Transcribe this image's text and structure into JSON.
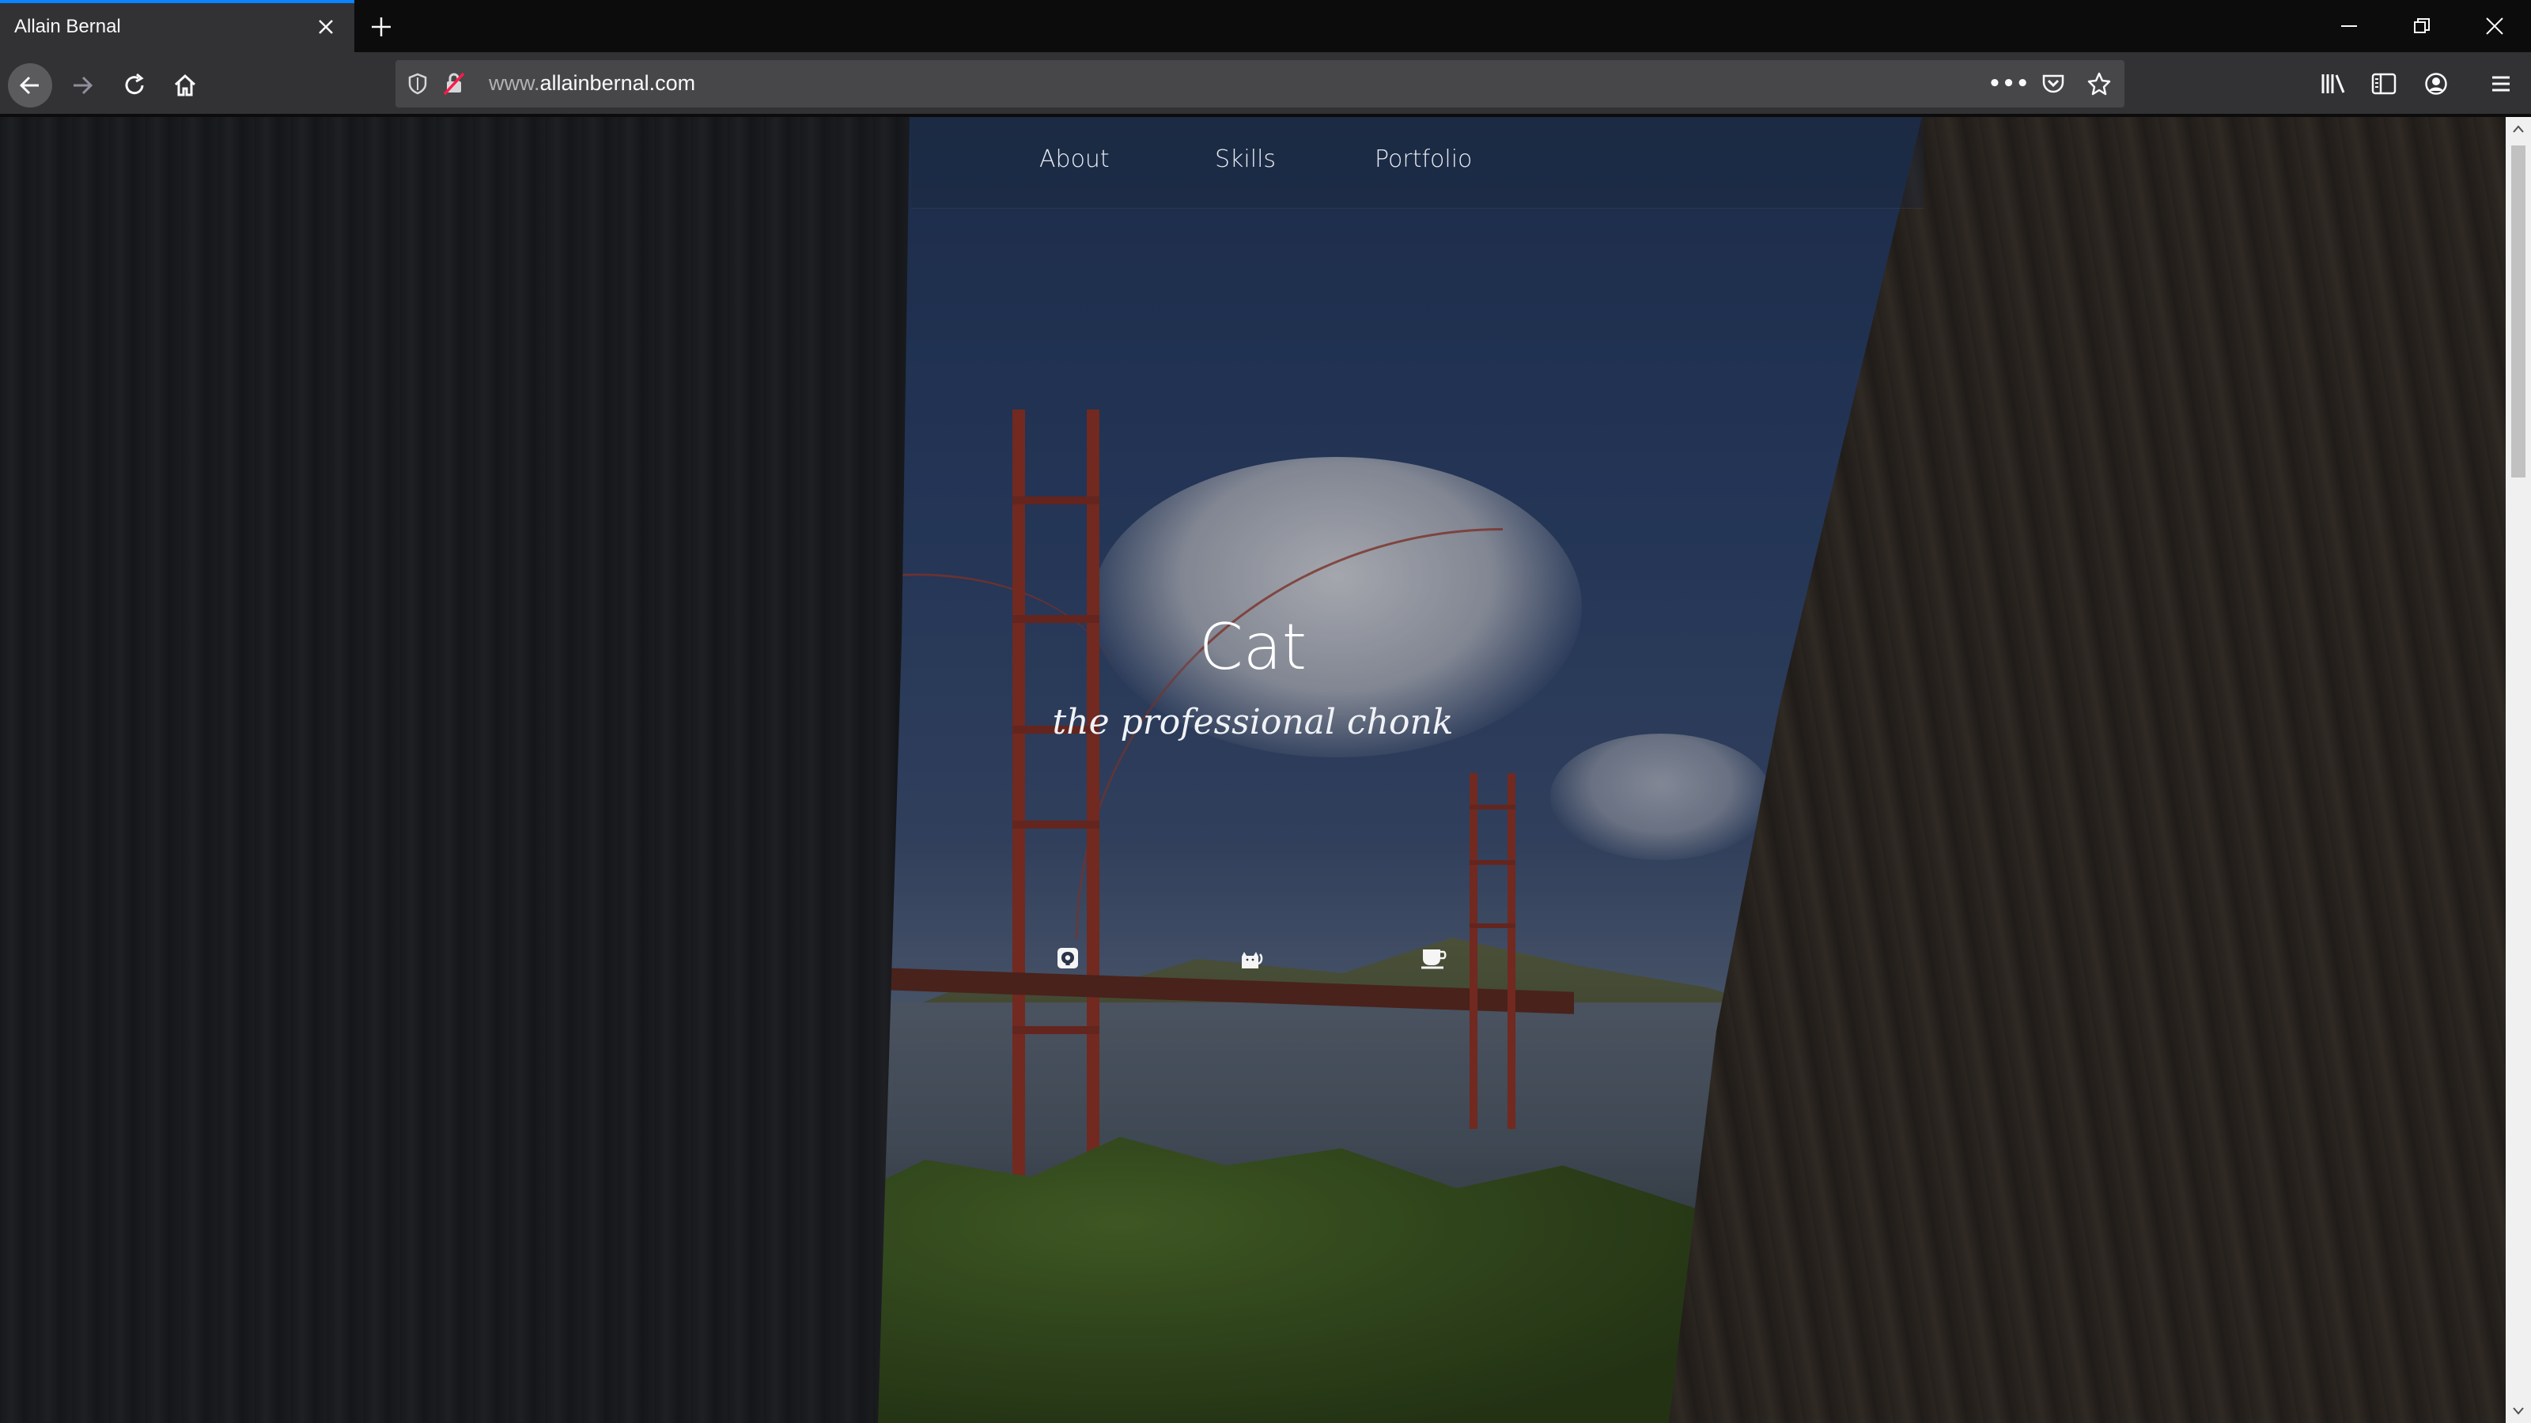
{
  "browser": {
    "tab_title": "Allain Bernal",
    "url_prefix": "www.",
    "url_host": "allainbernal.com",
    "page_actions_label": "•••"
  },
  "site": {
    "nav": [
      "About",
      "Skills",
      "Portfolio"
    ],
    "title": "Cat",
    "subtitle": "the professional chonk",
    "social_icons": [
      "github-icon",
      "cat-icon",
      "coffee-icon"
    ]
  },
  "colors": {
    "chrome_dark": "#0c0c0d",
    "chrome_toolbar": "#323234",
    "urlbar": "#474749",
    "tab_accent": "#0a84ff"
  }
}
